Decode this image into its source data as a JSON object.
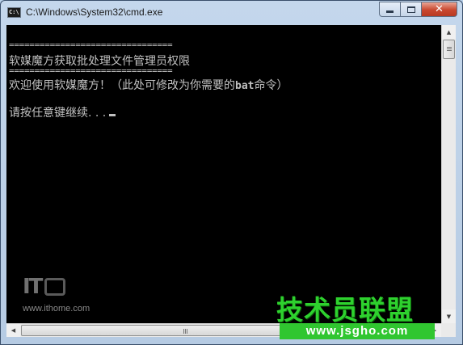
{
  "window": {
    "title": "C:\\Windows\\System32\\cmd.exe",
    "icon_label": "C:\\",
    "buttons": {
      "minimize": "minimize-icon",
      "maximize": "maximize-icon",
      "close": "✕"
    }
  },
  "console": {
    "separator_1": "================================",
    "heading": "软媒魔方获取批处理文件管理员权限",
    "separator_2": "================================",
    "welcome_prefix": "欢迎使用软媒魔方！（此处可修改为你需要的",
    "welcome_bat": "bat",
    "welcome_suffix": "命令）",
    "prompt": "请按任意键继续. . ."
  },
  "watermarks": {
    "ithome_logo": "IT",
    "ithome_url": "www.ithome.com",
    "jsgho_title": "技术员联盟",
    "jsgho_url": "www.jsgho.com"
  },
  "colors": {
    "console_bg": "#000000",
    "console_text": "#c0c0c0",
    "jsgho_green": "#2ed12e"
  }
}
